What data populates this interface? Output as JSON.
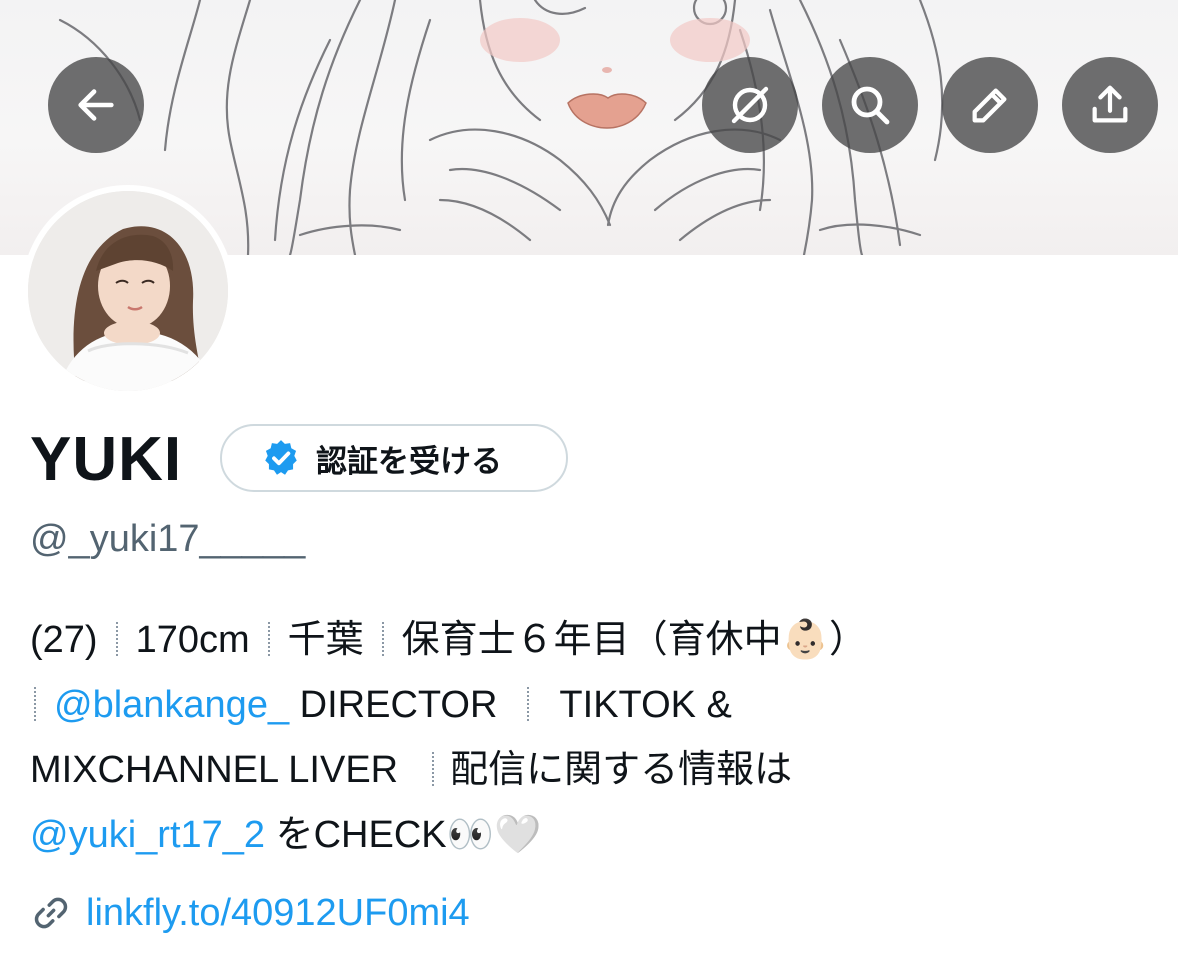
{
  "profile": {
    "name": "YUKI",
    "handle": "@_yuki17_____",
    "verify_button_label": "認証を受ける",
    "bio_line1": {
      "age": "(27)",
      "height": "170cm",
      "place": "千葉",
      "job": "保育士６年目（育休中",
      "emoji_baby": "👶🏻",
      "close": "）"
    },
    "bio_line2": {
      "mention": "@blankange_",
      "role": "DIRECTOR",
      "tiktok": "TIKTOK &"
    },
    "bio_line3": {
      "mixchannel": "MIXCHANNEL LIVER",
      "info": "配信に関する情報は"
    },
    "bio_line4": {
      "mention": "@yuki_rt17_2",
      "check": "をCHECK",
      "emoji_eyes": "👀",
      "emoji_heart": "🤍"
    },
    "link": "linkfly.to/40912UF0mi4"
  },
  "icons": {
    "back": "arrow-left-icon",
    "grok": "grok-icon",
    "search": "search-icon",
    "edit": "pencil-icon",
    "share": "share-icon",
    "verified": "verified-badge-icon",
    "link": "link-icon"
  },
  "colors": {
    "accent": "#1d9bf0",
    "text": "#0f1419",
    "secondary": "#536471",
    "fab": "#464648"
  }
}
